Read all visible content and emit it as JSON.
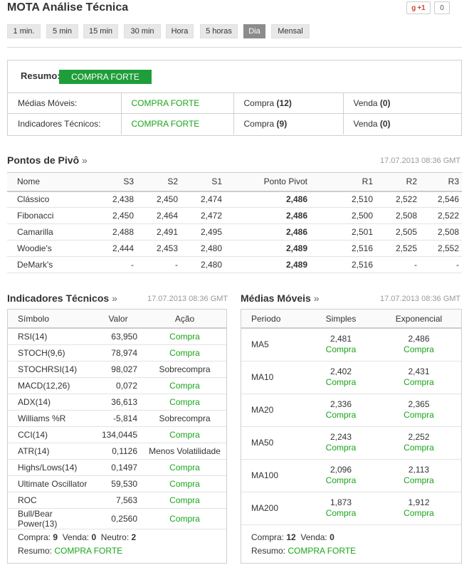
{
  "header": {
    "title": "MOTA Análise Técnica",
    "gplus_label": "+1",
    "gplus_count": "0"
  },
  "timeframes": [
    "1 min.",
    "5 min",
    "15 min",
    "30 min",
    "Hora",
    "5 horas",
    "Dia",
    "Mensal"
  ],
  "active_timeframe": "Dia",
  "summary": {
    "label": "Resumo:",
    "value": "COMPRA FORTE",
    "rows": [
      {
        "label": "Médias Móveis:",
        "value": "COMPRA FORTE",
        "buy_label": "Compra",
        "buy_count": "(12)",
        "sell_label": "Venda",
        "sell_count": "(0)"
      },
      {
        "label": "Indicadores Técnicos:",
        "value": "COMPRA FORTE",
        "buy_label": "Compra",
        "buy_count": "(9)",
        "sell_label": "Venda",
        "sell_count": "(0)"
      }
    ]
  },
  "pivots": {
    "title": "Pontos de Pivô",
    "arrow": "»",
    "timestamp": "17.07.2013 08:36 GMT",
    "headers": [
      "Nome",
      "S3",
      "S2",
      "S1",
      "Ponto Pivot",
      "R1",
      "R2",
      "R3"
    ],
    "rows": [
      [
        "Clássico",
        "2,438",
        "2,450",
        "2,474",
        "2,486",
        "2,510",
        "2,522",
        "2,546"
      ],
      [
        "Fibonacci",
        "2,450",
        "2,464",
        "2,472",
        "2,486",
        "2,500",
        "2,508",
        "2,522"
      ],
      [
        "Camarilla",
        "2,488",
        "2,491",
        "2,495",
        "2,486",
        "2,501",
        "2,505",
        "2,508"
      ],
      [
        "Woodie's",
        "2,444",
        "2,453",
        "2,480",
        "2,489",
        "2,516",
        "2,525",
        "2,552"
      ],
      [
        "DeMark's",
        "-",
        "-",
        "2,480",
        "2,489",
        "2,516",
        "-",
        "-"
      ]
    ]
  },
  "indicators": {
    "title": "Indicadores Técnicos",
    "arrow": "»",
    "timestamp": "17.07.2013 08:36 GMT",
    "headers": [
      "Símbolo",
      "Valor",
      "Ação"
    ],
    "rows": [
      [
        "RSI(14)",
        "63,950",
        "Compra"
      ],
      [
        "STOCH(9,6)",
        "78,974",
        "Compra"
      ],
      [
        "STOCHRSI(14)",
        "98,027",
        "Sobrecompra"
      ],
      [
        "MACD(12,26)",
        "0,072",
        "Compra"
      ],
      [
        "ADX(14)",
        "36,613",
        "Compra"
      ],
      [
        "Williams %R",
        "-5,814",
        "Sobrecompra"
      ],
      [
        "CCI(14)",
        "134,0445",
        "Compra"
      ],
      [
        "ATR(14)",
        "0,1126",
        "Menos Volatilidade"
      ],
      [
        "Highs/Lows(14)",
        "0,1497",
        "Compra"
      ],
      [
        "Ultimate Oscillator",
        "59,530",
        "Compra"
      ],
      [
        "ROC",
        "7,563",
        "Compra"
      ],
      [
        "Bull/Bear Power(13)",
        "0,2560",
        "Compra"
      ]
    ],
    "footer": {
      "buy_label": "Compra:",
      "buy": "9",
      "sell_label": "Venda:",
      "sell": "0",
      "neutral_label": "Neutro:",
      "neutral": "2",
      "summary_label": "Resumo:",
      "summary": "COMPRA FORTE"
    }
  },
  "moving_averages": {
    "title": "Médias Móveis",
    "arrow": "»",
    "timestamp": "17.07.2013 08:36 GMT",
    "headers": [
      "Periodo",
      "Simples",
      "Exponencial"
    ],
    "rows": [
      {
        "period": "MA5",
        "simple": "2,481",
        "simple_action": "Compra",
        "exp": "2,486",
        "exp_action": "Compra"
      },
      {
        "period": "MA10",
        "simple": "2,402",
        "simple_action": "Compra",
        "exp": "2,431",
        "exp_action": "Compra"
      },
      {
        "period": "MA20",
        "simple": "2,336",
        "simple_action": "Compra",
        "exp": "2,365",
        "exp_action": "Compra"
      },
      {
        "period": "MA50",
        "simple": "2,243",
        "simple_action": "Compra",
        "exp": "2,252",
        "exp_action": "Compra"
      },
      {
        "period": "MA100",
        "simple": "2,096",
        "simple_action": "Compra",
        "exp": "2,113",
        "exp_action": "Compra"
      },
      {
        "period": "MA200",
        "simple": "1,873",
        "simple_action": "Compra",
        "exp": "1,912",
        "exp_action": "Compra"
      }
    ],
    "footer": {
      "buy_label": "Compra:",
      "buy": "12",
      "sell_label": "Venda:",
      "sell": "0",
      "summary_label": "Resumo:",
      "summary": "COMPRA FORTE"
    }
  },
  "colors": {
    "buy_green": "#1aa51a",
    "badge_green": "#1e9e3a",
    "active_tab": "#8c8c8c"
  }
}
